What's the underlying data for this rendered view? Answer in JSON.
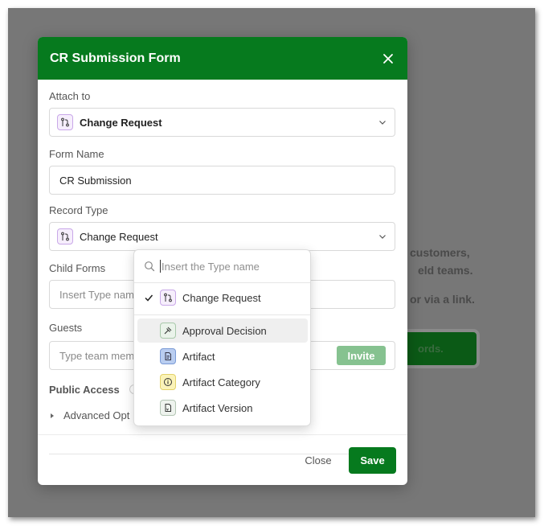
{
  "background": {
    "text_line1": "customers,",
    "text_line2": "eld teams.",
    "text_line3": "or via a link.",
    "cta_text": "ords."
  },
  "modal": {
    "title": "CR Submission Form",
    "attach_to": {
      "label": "Attach to",
      "value": "Change Request",
      "icon": "git-pull-request-icon"
    },
    "form_name": {
      "label": "Form Name",
      "value": "CR Submission"
    },
    "record_type": {
      "label": "Record Type",
      "value": "Change Request",
      "icon": "git-pull-request-icon"
    },
    "child_forms": {
      "label": "Child Forms",
      "placeholder": "Insert Type nam"
    },
    "guests": {
      "label": "Guests",
      "placeholder": "Type team mem",
      "invite_label": "Invite"
    },
    "public_access": {
      "label": "Public Access"
    },
    "advanced": {
      "label": "Advanced Opt"
    },
    "footer": {
      "close_label": "Close",
      "save_label": "Save"
    }
  },
  "dropdown": {
    "search_placeholder": "Insert the Type name",
    "selected": {
      "label": "Change Request",
      "icon": "git-pull-request-icon"
    },
    "items": [
      {
        "label": "Approval Decision",
        "icon": "gavel-icon",
        "hovered": true
      },
      {
        "label": "Artifact",
        "icon": "document-icon"
      },
      {
        "label": "Artifact Category",
        "icon": "info-circle-icon"
      },
      {
        "label": "Artifact Version",
        "icon": "file-version-icon"
      }
    ]
  },
  "colors": {
    "brand_green": "#067a1e",
    "overlay": "#777777",
    "invite_disabled": "#86c290"
  }
}
